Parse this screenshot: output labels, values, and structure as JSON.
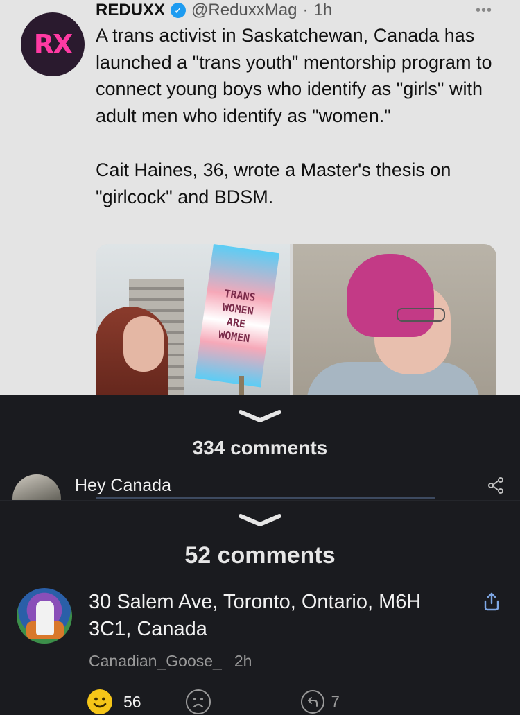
{
  "tweet": {
    "author_name": "REDUXX",
    "handle": "@ReduxxMag",
    "time": "1h",
    "avatar_logo": "RX",
    "paragraph_1": "A trans activist in Saskatchewan, Canada has launched a \"trans youth\" mentorship program to connect young boys who identify as \"girls\" with adult men who identify as \"women.\"",
    "paragraph_2": "Cait Haines, 36, wrote a Master's thesis on \"girlcock\" and BDSM.",
    "sign_text": [
      "TRANS",
      "WOMEN",
      "ARE",
      "WOMEN"
    ]
  },
  "thread_1": {
    "comment_count": "334 comments",
    "preview_comment": "Hey Canada"
  },
  "thread_2": {
    "comment_count": "52 comments",
    "comment": {
      "text": "30 Salem Ave, Toronto, Ontario, M6H 3C1, Canada",
      "username": "Canadian_Goose_",
      "age": "2h",
      "smile_count": "56",
      "reply_count": "7"
    }
  },
  "colors": {
    "background": "#1a1b1f",
    "tweet_background": "#e4e4e4",
    "brand_pink": "#ff3aa3",
    "verified_blue": "#1d9bf0",
    "smile_yellow": "#f5c518"
  },
  "icons": [
    "verified-icon",
    "more-icon",
    "chevron-down-icon",
    "share-icon",
    "smile-icon",
    "frown-icon",
    "reply-icon"
  ]
}
